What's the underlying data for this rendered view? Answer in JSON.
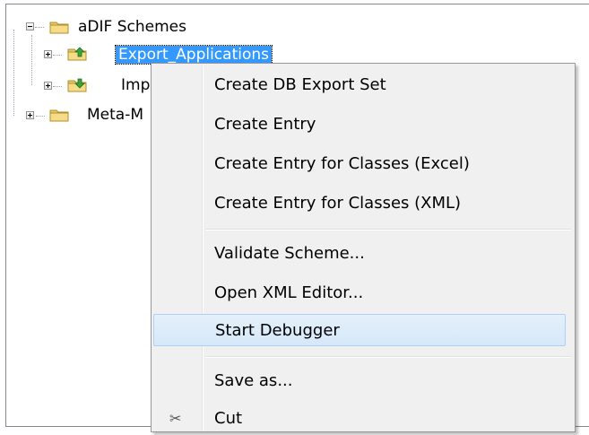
{
  "tree": {
    "items": [
      {
        "label": "aDIF Schemes",
        "expanded": true
      },
      {
        "label": "Export_Applications",
        "selected": true
      },
      {
        "label": "Imp"
      },
      {
        "label": "Meta-M"
      }
    ]
  },
  "menu": {
    "items": [
      {
        "label": "Create DB Export Set"
      },
      {
        "label": "Create Entry"
      },
      {
        "label": "Create Entry for Classes (Excel)"
      },
      {
        "label": "Create Entry for Classes (XML)"
      },
      {
        "label": "Validate Scheme..."
      },
      {
        "label": "Open XML Editor..."
      },
      {
        "label": "Start Debugger",
        "highlighted": true
      },
      {
        "label": "Save as..."
      },
      {
        "label": "Cut",
        "icon": "cut-icon",
        "icon_glyph": "✂"
      }
    ]
  },
  "colors": {
    "selection": "#3399ff",
    "menu_background": "#f0f0f0",
    "menu_hover": "#d6e8f9",
    "menu_hover_border": "#aecff7"
  }
}
